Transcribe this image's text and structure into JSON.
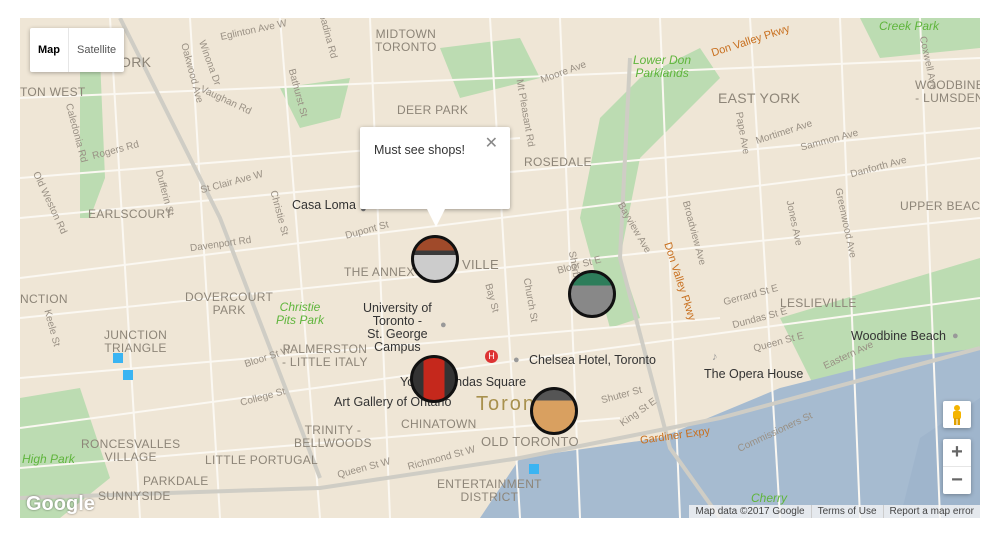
{
  "map_type": {
    "map": "Map",
    "satellite": "Satellite",
    "selected": "Map"
  },
  "info_window": {
    "text": "Must see shops!",
    "close_icon": "close-icon"
  },
  "labels": {
    "neighborhoods": [
      "MIDTOWN\nTORONTO",
      "DEER PARK",
      "ROSEDALE",
      "EAST YORK",
      "WOODBINE\n- LUMSDEN",
      "UPPER BEACHES",
      "LESLIEVILLE",
      "EARLSCOURT",
      "DOVERCOURT\nPARK",
      "JUNCTION\nTRIANGLE",
      "PALMERSTON\n- LITTLE ITALY",
      "TRINITY -\nBELLWOODS",
      "RONCESVALLES\nVILLAGE",
      "LITTLE PORTUGAL",
      "PARKDALE",
      "SUNNYSIDE",
      "CHINATOWN",
      "OLD TORONTO",
      "ENTERTAINMENT\nDISTRICT",
      "THE ANNEX",
      "VILLE",
      "ORK",
      "TON WEST",
      "NCTION"
    ],
    "parks": [
      "Creek Park",
      "Lower Don\nParklands",
      "Christie\nPits Park",
      "High Park",
      "Cherry"
    ],
    "highways": [
      "Don Valley Pkwy",
      "Gardiner Expy",
      "Don Valley Pkwy"
    ],
    "pois": [
      "Casa Loma",
      "University of\nToronto -\nSt. George\nCampus",
      "Chelsea Hotel, Toronto",
      "Yonge-Dundas Square",
      "Art Gallery of Ontario",
      "The Opera House",
      "Woodbine Beach"
    ],
    "city": "Toronto",
    "streets": [
      "Eglinton Ave W",
      "Spadina Rd",
      "Oakwood Ave",
      "Winona Dr",
      "Vaughan Rd",
      "Bathurst St",
      "Caledonia Rd",
      "Rogers Rd",
      "Dufferin St",
      "St Clair Ave W",
      "Christie St",
      "Old Weston Rd",
      "Davenport Rd",
      "Dupont St",
      "Moore Ave",
      "Mt Pleasant Rd",
      "Bayview Ave",
      "Broadview Ave",
      "Pape Ave",
      "Mortimer Ave",
      "Sammon Ave",
      "Danforth Ave",
      "Coxwell Ave",
      "Greenwood Ave",
      "Jones Ave",
      "Bloor St E",
      "Bay St",
      "Church St",
      "Sherbourne St",
      "Gerrard St E",
      "Dundas St E",
      "Queen St E",
      "Eastern Ave",
      "Bloor St W",
      "Keele St",
      "College St",
      "Queen St W",
      "Richmond St W",
      "Shuter St",
      "King St E",
      "Commissioners St"
    ]
  },
  "markers": [
    {
      "name": "shop-1"
    },
    {
      "name": "shop-2"
    },
    {
      "name": "shop-3"
    },
    {
      "name": "shop-4"
    }
  ],
  "attribution": {
    "map_data": "Map data ©2017 Google",
    "terms": "Terms of Use",
    "report": "Report a map error"
  },
  "logo": "Google",
  "colors": {
    "land": "#efe6d6",
    "park": "#b9dbb0",
    "water": "#a3b8cf",
    "road": "#fbf8f2",
    "highway": "#c8c8c0"
  }
}
